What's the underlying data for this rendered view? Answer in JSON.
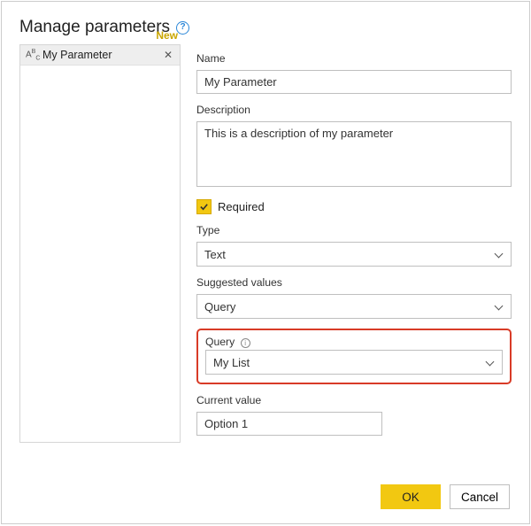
{
  "header": {
    "title": "Manage parameters"
  },
  "sidebar": {
    "new_label": "New",
    "items": [
      {
        "icon": "ABC",
        "name": "My Parameter"
      }
    ]
  },
  "form": {
    "name_label": "Name",
    "name_value": "My Parameter",
    "description_label": "Description",
    "description_value": "This is a description of my parameter",
    "required_label": "Required",
    "required_checked": true,
    "type_label": "Type",
    "type_value": "Text",
    "suggested_label": "Suggested values",
    "suggested_value": "Query",
    "query_label": "Query",
    "query_value": "My List",
    "current_label": "Current value",
    "current_value": "Option 1"
  },
  "footer": {
    "ok_label": "OK",
    "cancel_label": "Cancel"
  }
}
